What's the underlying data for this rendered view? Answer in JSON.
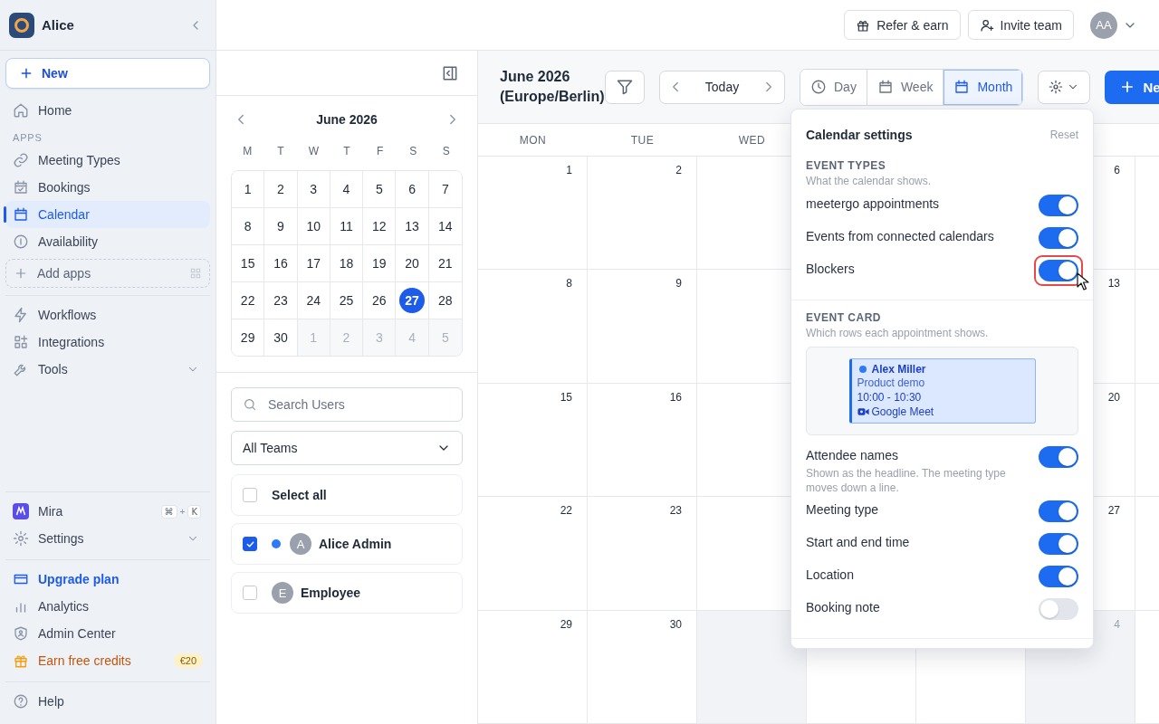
{
  "sidebar": {
    "workspace": "Alice",
    "new_button": "New",
    "top_items": [
      {
        "label": "Home",
        "selected": false
      }
    ],
    "apps_heading": "APPS",
    "apps": [
      {
        "label": "Meeting Types",
        "selected": false
      },
      {
        "label": "Bookings",
        "selected": false
      },
      {
        "label": "Calendar",
        "selected": true
      },
      {
        "label": "Availability",
        "selected": false
      }
    ],
    "add_apps": "Add apps",
    "tools": [
      {
        "label": "Workflows",
        "expandable": false
      },
      {
        "label": "Integrations",
        "expandable": false
      },
      {
        "label": "Tools",
        "expandable": true
      }
    ],
    "assistant": {
      "label": "Mira",
      "shortcut": [
        "⌘",
        "+",
        "K"
      ]
    },
    "settings": {
      "label": "Settings",
      "expandable": true
    },
    "account": [
      {
        "label": "Upgrade plan",
        "kind": "highlight"
      },
      {
        "label": "Analytics",
        "kind": "plain"
      },
      {
        "label": "Admin Center",
        "kind": "plain"
      },
      {
        "label": "Earn free credits",
        "kind": "promo",
        "badge": "€20"
      }
    ],
    "help": "Help"
  },
  "topbar": {
    "buttons": [
      "Refer & earn",
      "Invite team"
    ],
    "avatar": "AA"
  },
  "mini_calendar": {
    "month": "June 2026",
    "weekdays": [
      "M",
      "T",
      "W",
      "T",
      "F",
      "S",
      "S"
    ],
    "weeks": [
      [
        {
          "day": "1",
          "outside": false,
          "selected": false
        },
        {
          "day": "2",
          "outside": false,
          "selected": false
        },
        {
          "day": "3",
          "outside": false,
          "selected": false
        },
        {
          "day": "4",
          "outside": false,
          "selected": false
        },
        {
          "day": "5",
          "outside": false,
          "selected": false
        },
        {
          "day": "6",
          "outside": false,
          "selected": false
        },
        {
          "day": "7",
          "outside": false,
          "selected": false
        }
      ],
      [
        {
          "day": "8",
          "outside": false,
          "selected": false
        },
        {
          "day": "9",
          "outside": false,
          "selected": false
        },
        {
          "day": "10",
          "outside": false,
          "selected": false
        },
        {
          "day": "11",
          "outside": false,
          "selected": false
        },
        {
          "day": "12",
          "outside": false,
          "selected": false
        },
        {
          "day": "13",
          "outside": false,
          "selected": false
        },
        {
          "day": "14",
          "outside": false,
          "selected": false
        }
      ],
      [
        {
          "day": "15",
          "outside": false,
          "selected": false
        },
        {
          "day": "16",
          "outside": false,
          "selected": false
        },
        {
          "day": "17",
          "outside": false,
          "selected": false
        },
        {
          "day": "18",
          "outside": false,
          "selected": false
        },
        {
          "day": "19",
          "outside": false,
          "selected": false
        },
        {
          "day": "20",
          "outside": false,
          "selected": false
        },
        {
          "day": "21",
          "outside": false,
          "selected": false
        }
      ],
      [
        {
          "day": "22",
          "outside": false,
          "selected": false
        },
        {
          "day": "23",
          "outside": false,
          "selected": false
        },
        {
          "day": "24",
          "outside": false,
          "selected": false
        },
        {
          "day": "25",
          "outside": false,
          "selected": false
        },
        {
          "day": "26",
          "outside": false,
          "selected": false
        },
        {
          "day": "27",
          "outside": false,
          "selected": true
        },
        {
          "day": "28",
          "outside": false,
          "selected": false
        }
      ],
      [
        {
          "day": "29",
          "outside": false,
          "selected": false
        },
        {
          "day": "30",
          "outside": false,
          "selected": false
        },
        {
          "day": "1",
          "outside": true,
          "selected": false
        },
        {
          "day": "2",
          "outside": true,
          "selected": false
        },
        {
          "day": "3",
          "outside": true,
          "selected": false
        },
        {
          "day": "4",
          "outside": true,
          "selected": false
        },
        {
          "day": "5",
          "outside": true,
          "selected": false
        }
      ]
    ]
  },
  "user_filter": {
    "search_placeholder": "Search Users",
    "team": "All Teams",
    "select_all": {
      "label": "Select all",
      "checked": false
    },
    "users": [
      {
        "name": "Alice Admin",
        "initial": "A",
        "checked": true,
        "color": "#2f7bf5"
      },
      {
        "name": "Employee",
        "initial": "E",
        "checked": false
      }
    ]
  },
  "toolbar": {
    "title": "June 2026 (Europe/Berlin)",
    "today": "Today",
    "views": [
      {
        "label": "Day",
        "selected": false
      },
      {
        "label": "Week",
        "selected": false
      },
      {
        "label": "Month",
        "selected": true
      }
    ],
    "new_button": "Ne"
  },
  "calendar": {
    "weekday_headers": [
      "MON",
      "TUE",
      "WED"
    ],
    "weeks": [
      {
        "cells": [
          {
            "day": "1"
          },
          {
            "day": "2"
          },
          {},
          {},
          {},
          {
            "day": "6"
          },
          {}
        ]
      },
      {
        "cells": [
          {
            "day": "8"
          },
          {
            "day": "9"
          },
          {},
          {},
          {},
          {
            "day": "13"
          },
          {}
        ]
      },
      {
        "cells": [
          {
            "day": "15"
          },
          {
            "day": "16"
          },
          {},
          {},
          {},
          {
            "day": "20"
          },
          {}
        ]
      },
      {
        "cells": [
          {
            "day": "22"
          },
          {
            "day": "23"
          },
          {},
          {},
          {},
          {
            "day": "27"
          },
          {}
        ]
      },
      {
        "cells": [
          {
            "day": "29",
            "outside": false
          },
          {
            "day": "30",
            "outside": false
          },
          {
            "outside": true
          },
          {},
          {},
          {
            "day": "4",
            "outside": true
          },
          {}
        ]
      }
    ]
  },
  "settings_popover": {
    "title": "Calendar settings",
    "reset": "Reset",
    "event_types": {
      "heading": "EVENT TYPES",
      "hint": "What the calendar shows.",
      "options": [
        {
          "label": "meetergo appointments",
          "on": true,
          "highlighted": false
        },
        {
          "label": "Events from connected calendars",
          "on": true,
          "highlighted": false
        },
        {
          "label": "Blockers",
          "on": true,
          "highlighted": true
        }
      ]
    },
    "event_card": {
      "heading": "EVENT CARD",
      "hint": "Which rows each appointment shows.",
      "preview": {
        "attendee": "Alex Miller",
        "meeting_type": "Product demo",
        "time": "10:00 - 10:30",
        "location": "Google Meet"
      },
      "options": [
        {
          "label": "Attendee names",
          "hint": "Shown as the headline. The meeting type moves down a line.",
          "on": true,
          "highlighted": false
        },
        {
          "label": "Meeting type",
          "on": true,
          "highlighted": false
        },
        {
          "label": "Start and end time",
          "on": true,
          "highlighted": false
        },
        {
          "label": "Location",
          "on": true,
          "highlighted": false
        },
        {
          "label": "Booking note",
          "on": false,
          "highlighted": false
        }
      ]
    }
  }
}
